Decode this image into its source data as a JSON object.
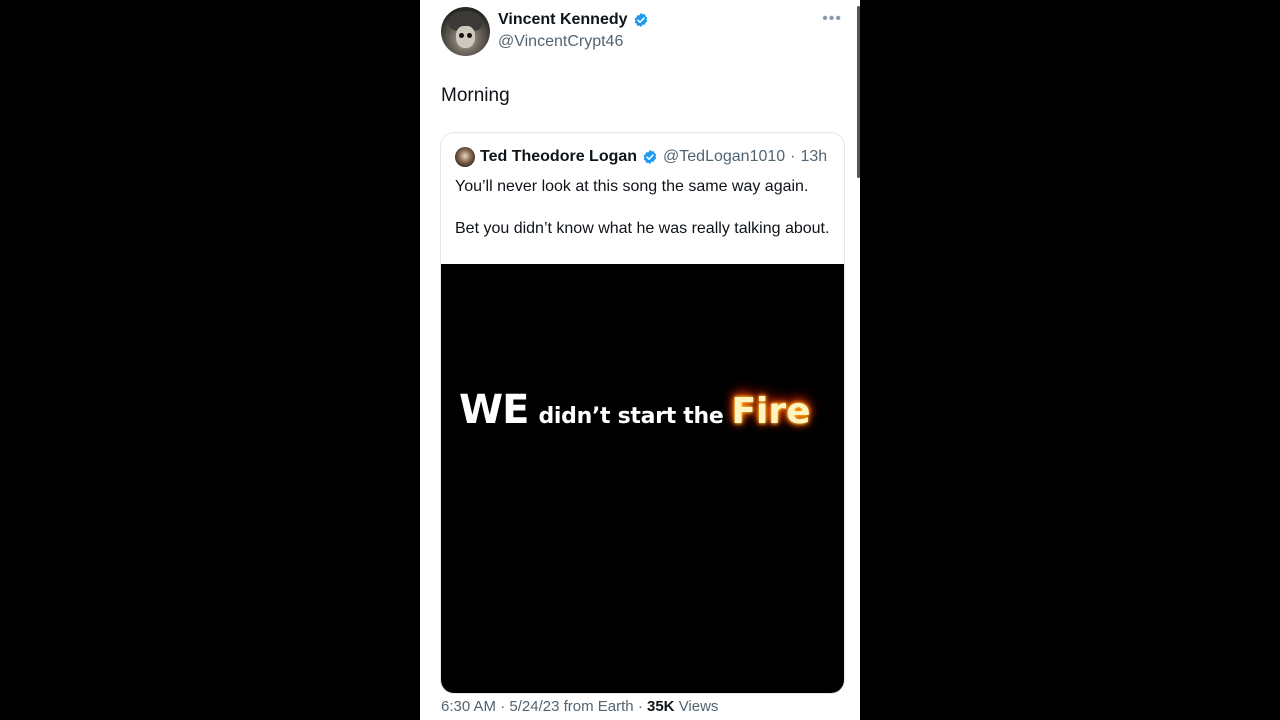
{
  "author": {
    "name": "Vincent Kennedy",
    "handle": "@VincentCrypt46",
    "avatar_icon": "soldier-skull-avatar",
    "verified": true
  },
  "menu_icon": "more-horizontal-icon",
  "tweet": {
    "text": "Morning"
  },
  "quoted_tweet": {
    "author_name": "Ted Theodore Logan",
    "author_handle": "@TedLogan1010",
    "separator": "·",
    "time_ago": "13h",
    "verified": true,
    "text_line1": "You’ll never look at this song the same way again.",
    "text_line2": "Bet you didn’t know what he was really talking about.",
    "media": {
      "caption_we": "WE",
      "caption_middle": "didn’t start the",
      "caption_fire": "Fire"
    }
  },
  "footer": {
    "time": "6:30 AM",
    "dot1": "·",
    "date": "5/24/23",
    "source": "from Earth",
    "dot2": "·",
    "views_count": "35K",
    "views_label": "Views"
  },
  "colors": {
    "verified_blue": "#1d9bf0",
    "text_primary": "#0f1419",
    "text_secondary": "#536471",
    "background_outside": "#000000"
  }
}
